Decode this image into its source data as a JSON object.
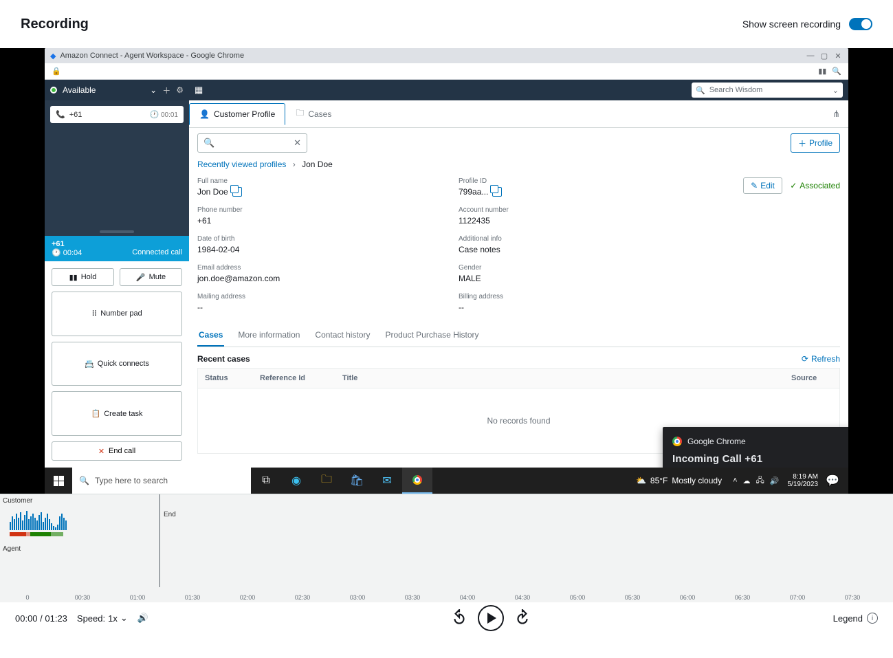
{
  "header": {
    "title": "Recording",
    "toggle_label": "Show screen recording"
  },
  "chrome": {
    "title": "Amazon Connect - Agent Workspace - Google Chrome",
    "notification": {
      "app": "Google Chrome",
      "body": "Incoming Call +61"
    }
  },
  "ccp": {
    "status": "Available",
    "contact": {
      "number": "+61",
      "timer": "00:01"
    },
    "connected": {
      "number": "+61",
      "elapsed": "00:04",
      "state": "Connected call"
    },
    "buttons": {
      "hold": "Hold",
      "mute": "Mute",
      "numpad": "Number pad",
      "quick": "Quick connects",
      "task": "Create task",
      "end": "End call"
    }
  },
  "workspace": {
    "search_placeholder": "Search Wisdom",
    "tabs": {
      "profile": "Customer Profile",
      "cases": "Cases"
    },
    "add_profile": "Profile",
    "breadcrumb": {
      "root": "Recently viewed profiles",
      "current": "Jon Doe"
    },
    "fields": {
      "full_name_lbl": "Full name",
      "full_name": "Jon Doe",
      "profile_id_lbl": "Profile ID",
      "profile_id": "799aa...",
      "phone_lbl": "Phone number",
      "phone": "+61",
      "account_lbl": "Account number",
      "account": "1122435",
      "dob_lbl": "Date of birth",
      "dob": "1984-02-04",
      "addl_lbl": "Additional info",
      "addl": "Case notes",
      "email_lbl": "Email address",
      "email": "jon.doe@amazon.com",
      "gender_lbl": "Gender",
      "gender": "MALE",
      "mailing_lbl": "Mailing address",
      "mailing": "--",
      "billing_lbl": "Billing address",
      "billing": "--"
    },
    "edit": "Edit",
    "associated": "Associated",
    "subtabs": {
      "cases": "Cases",
      "more": "More information",
      "history": "Contact history",
      "purchase": "Product Purchase History"
    },
    "recent": "Recent cases",
    "refresh": "Refresh",
    "cols": {
      "status": "Status",
      "ref": "Reference Id",
      "title": "Title",
      "source": "Source"
    },
    "empty": "No records found"
  },
  "taskbar": {
    "search_placeholder": "Type here to search",
    "weather_temp": "85°F",
    "weather_cond": "Mostly cloudy",
    "time": "8:19 AM",
    "date": "5/19/2023"
  },
  "timeline": {
    "customer": "Customer",
    "agent": "Agent",
    "end": "End",
    "ticks": [
      "0",
      "00:30",
      "01:00",
      "01:30",
      "02:00",
      "02:30",
      "03:00",
      "03:30",
      "04:00",
      "04:30",
      "05:00",
      "05:30",
      "06:00",
      "06:30",
      "07:00",
      "07:30"
    ]
  },
  "player": {
    "position": "00:00 / 01:23",
    "speed_lbl": "Speed:",
    "speed_val": "1x",
    "legend": "Legend"
  }
}
